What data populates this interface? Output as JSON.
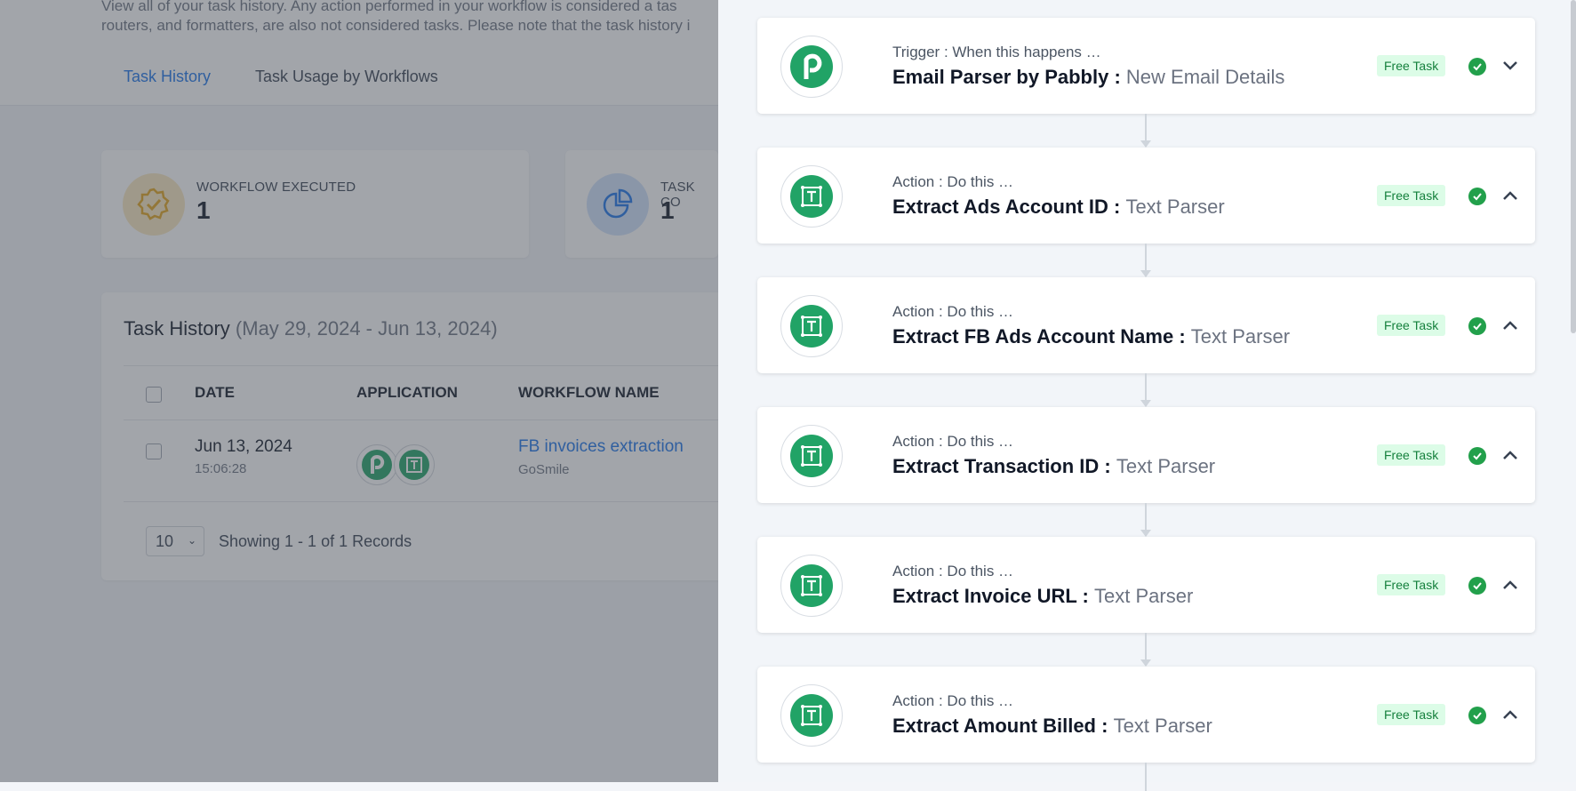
{
  "background": {
    "description_line1": "View all of your task history. Any action performed in your workflow is considered a tas",
    "description_line2": "routers, and formatters, are also not considered tasks. Please note that the task history i",
    "tabs": [
      {
        "label": "Task History",
        "active": true
      },
      {
        "label": "Task Usage by Workflows",
        "active": false
      }
    ],
    "stats": [
      {
        "label": "WORKFLOW EXECUTED",
        "value": "1",
        "icon": "badge-check-icon"
      },
      {
        "label": "TASK CO",
        "value": "1",
        "icon": "pie-chart-icon"
      }
    ],
    "history": {
      "title": "Task History",
      "range": "(May 29, 2024 - Jun 13, 2024)",
      "columns": [
        "DATE",
        "APPLICATION",
        "WORKFLOW NAME"
      ],
      "rows": [
        {
          "date": "Jun 13, 2024",
          "time": "15:06:28",
          "workflow": "FB invoices extraction",
          "owner": "GoSmile"
        }
      ],
      "page_size": "10",
      "showing": "Showing 1 - 1 of 1 Records"
    }
  },
  "drawer": {
    "badge_label": "Free Task",
    "steps": [
      {
        "kind": "Trigger : When this happens …",
        "name": "Email Parser by Pabbly :",
        "app": "New Email Details",
        "icon": "pabbly-logo-icon",
        "expanded": false
      },
      {
        "kind": "Action : Do this …",
        "name": "Extract Ads Account ID :",
        "app": "Text Parser",
        "icon": "text-parser-icon",
        "expanded": true
      },
      {
        "kind": "Action : Do this …",
        "name": "Extract FB Ads Account Name :",
        "app": "Text Parser",
        "icon": "text-parser-icon",
        "expanded": true
      },
      {
        "kind": "Action : Do this …",
        "name": "Extract Transaction ID :",
        "app": "Text Parser",
        "icon": "text-parser-icon",
        "expanded": true
      },
      {
        "kind": "Action : Do this …",
        "name": "Extract Invoice URL :",
        "app": "Text Parser",
        "icon": "text-parser-icon",
        "expanded": true
      },
      {
        "kind": "Action : Do this …",
        "name": "Extract Amount Billed :",
        "app": "Text Parser",
        "icon": "text-parser-icon",
        "expanded": true
      }
    ]
  },
  "colors": {
    "accent": "#1a73e8",
    "success": "#22a04b",
    "app_green": "#21a366",
    "badge_bg": "#dcfce7",
    "badge_text": "#15803d"
  }
}
